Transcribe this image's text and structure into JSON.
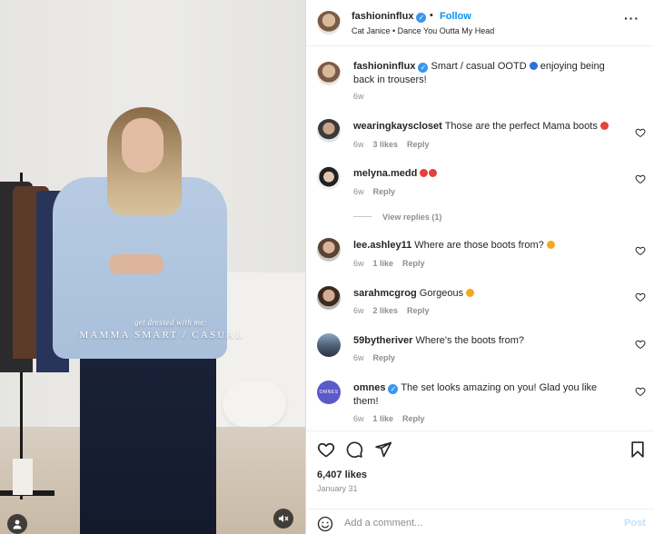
{
  "media": {
    "overlay_sub": "get dressed with me:",
    "overlay_main": "MAMMA SMART / CASUAL"
  },
  "header": {
    "username": "fashioninflux",
    "separator": "•",
    "follow_label": "Follow",
    "audio": "Cat Janice • Dance You Outta My Head",
    "more_label": "···"
  },
  "caption": {
    "username": "fashioninflux",
    "text": "Smart / casual OOTD",
    "text2": "enjoying being back in trousers!",
    "time": "6w"
  },
  "comments": [
    {
      "username": "wearingkayscloset",
      "text": "Those are the perfect Mama boots",
      "time": "6w",
      "likes": "3 likes",
      "reply": "Reply"
    },
    {
      "username": "melyna.medd",
      "text": "",
      "time": "6w",
      "likes": "",
      "reply": "Reply"
    },
    {
      "username": "lee.ashley11",
      "text": "Where are those boots from?",
      "time": "6w",
      "likes": "1 like",
      "reply": "Reply"
    },
    {
      "username": "sarahmcgrog",
      "text": "Gorgeous",
      "time": "6w",
      "likes": "2 likes",
      "reply": "Reply"
    },
    {
      "username": "59bytheriver",
      "text": "Where's the boots from?",
      "time": "6w",
      "likes": "",
      "reply": "Reply"
    },
    {
      "username": "omnes",
      "text": "The set looks amazing on you! Glad you like them!",
      "time": "6w",
      "likes": "1 like",
      "reply": "Reply"
    }
  ],
  "view_replies": "View replies (1)",
  "omnes_avatar_text": "OMNES",
  "footer": {
    "likes": "6,407 likes",
    "date": "January 31",
    "add_comment_placeholder": "Add a comment...",
    "post_label": "Post"
  },
  "colors": {
    "accent": "#0095f6",
    "verified": "#3897f0",
    "muted": "#8e8e8e",
    "heart_red": "#ed4956"
  },
  "icons": [
    "heart-icon",
    "comment-icon",
    "share-icon",
    "bookmark-icon",
    "more-icon",
    "emoji-icon",
    "verified-icon",
    "user-icon",
    "mute-icon"
  ]
}
